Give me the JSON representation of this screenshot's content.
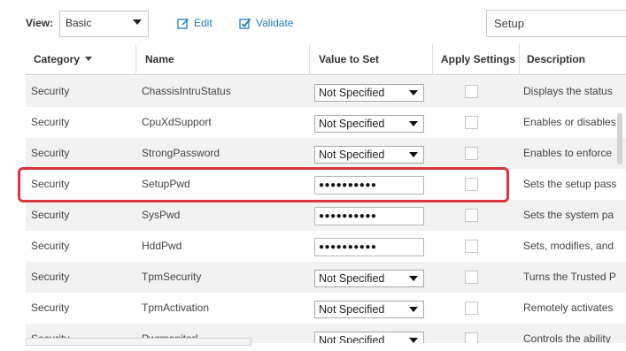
{
  "toolbar": {
    "view_label": "View:",
    "view_value": "Basic",
    "edit_label": "Edit",
    "validate_label": "Validate",
    "search_value": "Setup"
  },
  "grid": {
    "columns": [
      "Category",
      "Name",
      "Value to Set",
      "Apply Settings",
      "Description"
    ],
    "sorted_column": "Category",
    "rows": [
      {
        "category": "Security",
        "name": "ChassisIntruStatus",
        "value": "Not Specified",
        "value_type": "dropdown",
        "description": "Displays the status"
      },
      {
        "category": "Security",
        "name": "CpuXdSupport",
        "value": "Not Specified",
        "value_type": "dropdown",
        "description": "Enables or disables"
      },
      {
        "category": "Security",
        "name": "StrongPassword",
        "value": "Not Specified",
        "value_type": "dropdown",
        "description": "Enables to enforce"
      },
      {
        "category": "Security",
        "name": "SetupPwd",
        "value": "●●●●●●●●●●",
        "value_type": "password",
        "description": "Sets the setup pass",
        "highlighted": true
      },
      {
        "category": "Security",
        "name": "SysPwd",
        "value": "●●●●●●●●●●",
        "value_type": "password",
        "description": "Sets the system pa"
      },
      {
        "category": "Security",
        "name": "HddPwd",
        "value": "●●●●●●●●●●",
        "value_type": "password",
        "description": "Sets, modifies, and"
      },
      {
        "category": "Security",
        "name": "TpmSecurity",
        "value": "Not Specified",
        "value_type": "dropdown",
        "description": "Turns the Trusted P"
      },
      {
        "category": "Security",
        "name": "TpmActivation",
        "value": "Not Specified",
        "value_type": "dropdown",
        "description": "Remotely activates"
      },
      {
        "category": "Security",
        "name": "PwrmonitorL",
        "value": "Not Specified",
        "value_type": "dropdown",
        "description": "Controls the ability"
      }
    ]
  },
  "colors": {
    "link": "#1c7fc4",
    "highlight": "#d9363e",
    "row_alt": "#f2f2f2"
  }
}
